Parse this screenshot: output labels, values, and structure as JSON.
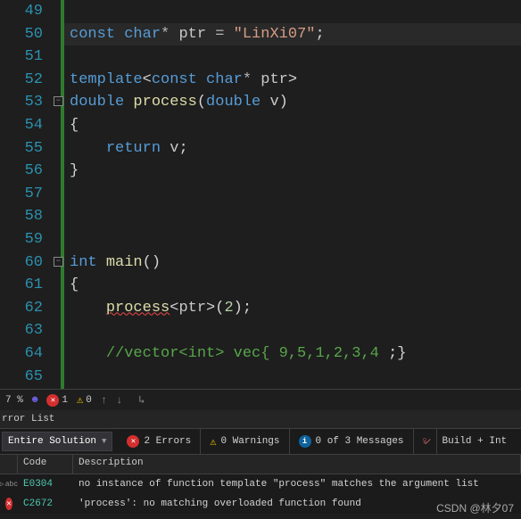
{
  "gutter": {
    "start": 49,
    "end": 65
  },
  "code": {
    "lines": [
      "",
      "{t:kw|const} {t:kw|char}{t:op|*} {t:id|ptr} {t:op|=} {t:str|\"LinXi07\"}{t:p|;}",
      "",
      "{t:kw|template}{t:p|<}{t:kw|const} {t:kw|char}{t:op|*} {t:id|ptr}{t:p|>}",
      "{t:kw|double} {t:fn|process}{t:p|(}{t:kw|double} {t:id|v}{t:p|)}",
      "{t:p|{}",
      "    {t:kw|return} {t:id|v}{t:p|;}",
      "{t:p|}}",
      "",
      "",
      "",
      "{t:kw|int} {t:fn|main}{t:p|()}",
      "{t:p|{}",
      "    {t:fn squiggle|process}{t:p|<}{t:id|ptr}{t:p|>(}{t:num|2}{t:p|);}",
      "",
      "    {t:cmt|//vector<int> vec{ 9,5,1,2,3,4 };}",
      ""
    ],
    "highlight_index": 1,
    "minus_indices": [
      4,
      11
    ]
  },
  "status": {
    "percent": "7 %",
    "errors": "1",
    "warnings": "0"
  },
  "panel_title": "rror List",
  "filter": {
    "scope": "Entire Solution",
    "errors": "2 Errors",
    "warnings": "0 Warnings",
    "messages": "0 of 3 Messages",
    "build": "Build + Int"
  },
  "table": {
    "code": "Code",
    "desc": "Description"
  },
  "errors": [
    {
      "icon": "abc",
      "code": "E0304",
      "desc": "no instance of function template \"process\" matches the argument list"
    },
    {
      "icon": "err",
      "code": "C2672",
      "desc": "'process': no matching overloaded function found"
    }
  ],
  "watermark": "CSDN @林夕07"
}
